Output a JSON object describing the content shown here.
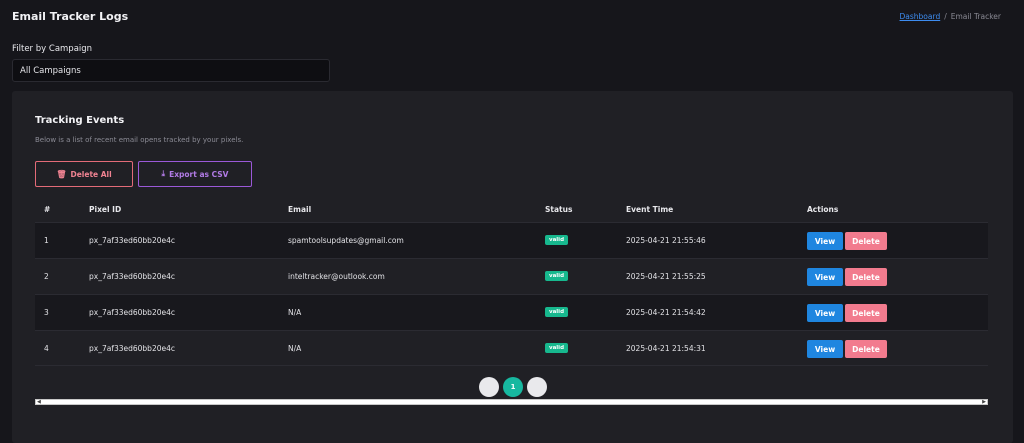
{
  "header": {
    "title": "Email Tracker Logs",
    "breadcrumb": {
      "link": "Dashboard",
      "separator": "/",
      "current": "Email Tracker"
    }
  },
  "filter": {
    "label": "Filter by Campaign",
    "selected": "All Campaigns"
  },
  "card": {
    "title": "Tracking Events",
    "subtitle": "Below is a list of recent email opens tracked by your pixels.",
    "delete_all_label": "Delete All",
    "export_label": "Export as CSV"
  },
  "table": {
    "columns": [
      "#",
      "Pixel ID",
      "Email",
      "Status",
      "Event Time",
      "Actions"
    ],
    "rows": [
      {
        "num": "1",
        "pixel_id": "px_7af33ed60bb20e4c",
        "email": "spamtoolsupdates@gmail.com",
        "status": "valid",
        "time": "2025-04-21 21:55:46"
      },
      {
        "num": "2",
        "pixel_id": "px_7af33ed60bb20e4c",
        "email": "inteltracker@outlook.com",
        "status": "valid",
        "time": "2025-04-21 21:55:25"
      },
      {
        "num": "3",
        "pixel_id": "px_7af33ed60bb20e4c",
        "email": "N/A",
        "status": "valid",
        "time": "2025-04-21 21:54:42"
      },
      {
        "num": "4",
        "pixel_id": "px_7af33ed60bb20e4c",
        "email": "N/A",
        "status": "valid",
        "time": "2025-04-21 21:54:31"
      }
    ],
    "view_label": "View",
    "delete_label": "Delete"
  },
  "pagination": {
    "prev": "‹",
    "current": "1",
    "next": "›"
  },
  "icons": {
    "delete_all": "trash-icon",
    "export": "download-icon"
  },
  "colors": {
    "accent": "#1f86e0",
    "danger": "#f27b8e",
    "success": "#17b88e",
    "purple": "#9b59d8"
  }
}
